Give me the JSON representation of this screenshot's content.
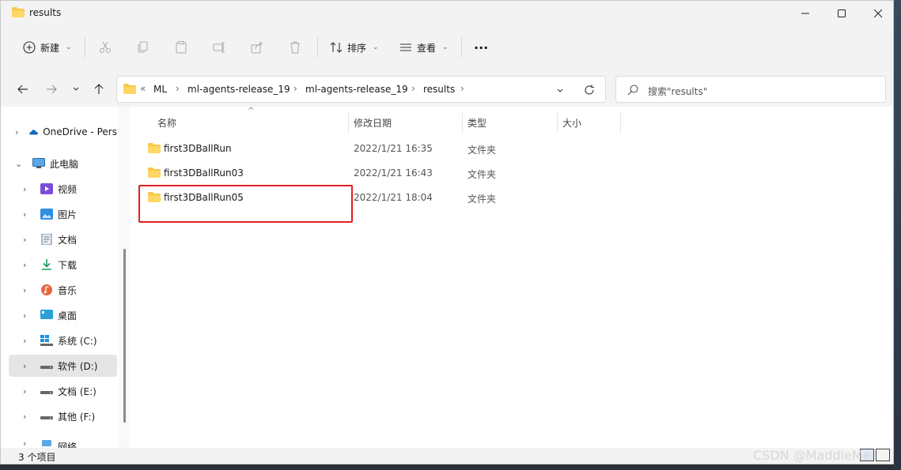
{
  "window": {
    "title": "results",
    "controls": [
      "minimize-icon",
      "maximize-icon",
      "close-icon"
    ]
  },
  "toolbar": {
    "new_label": "新建",
    "sort_label": "排序",
    "view_label": "查看",
    "more_label": "···",
    "icons": [
      "cut-icon",
      "copy-icon",
      "paste-icon",
      "rename-icon",
      "share-icon",
      "delete-icon"
    ]
  },
  "address": {
    "prefix": "«",
    "crumbs": [
      "ML",
      "ml-agents-release_19",
      "ml-agents-release_19",
      "results"
    ],
    "search_placeholder": "搜索\"results\""
  },
  "nav": {
    "items": [
      {
        "label": "OneDrive - Pers",
        "icon": "onedrive-icon",
        "expanded": false
      },
      {
        "label": "此电脑",
        "icon": "pc-icon",
        "expanded": true
      },
      {
        "label": "视频",
        "icon": "video-icon"
      },
      {
        "label": "图片",
        "icon": "pictures-icon"
      },
      {
        "label": "文档",
        "icon": "documents-icon"
      },
      {
        "label": "下载",
        "icon": "download-icon"
      },
      {
        "label": "音乐",
        "icon": "music-icon"
      },
      {
        "label": "桌面",
        "icon": "desktop-icon"
      },
      {
        "label": "系统 (C:)",
        "icon": "windows-drive-icon"
      },
      {
        "label": "软件 (D:)",
        "icon": "drive-icon",
        "selected": true
      },
      {
        "label": "文档 (E:)",
        "icon": "drive-icon"
      },
      {
        "label": "其他 (F:)",
        "icon": "drive-icon"
      },
      {
        "label": "网络",
        "icon": "network-icon"
      }
    ]
  },
  "columns": [
    "名称",
    "修改日期",
    "类型",
    "大小"
  ],
  "files": [
    {
      "name": "first3DBallRun",
      "date": "2022/1/21 16:35",
      "type": "文件夹"
    },
    {
      "name": "first3DBallRun03",
      "date": "2022/1/21 16:43",
      "type": "文件夹"
    },
    {
      "name": "first3DBallRun05",
      "date": "2022/1/21 18:04",
      "type": "文件夹"
    }
  ],
  "status": {
    "count_text": "3 个项目"
  },
  "watermark": "CSDN @MaddieMe",
  "colors": {
    "folder": "#f8c84a",
    "highlight": "#e02020",
    "onedrive": "#0f6cbd"
  }
}
